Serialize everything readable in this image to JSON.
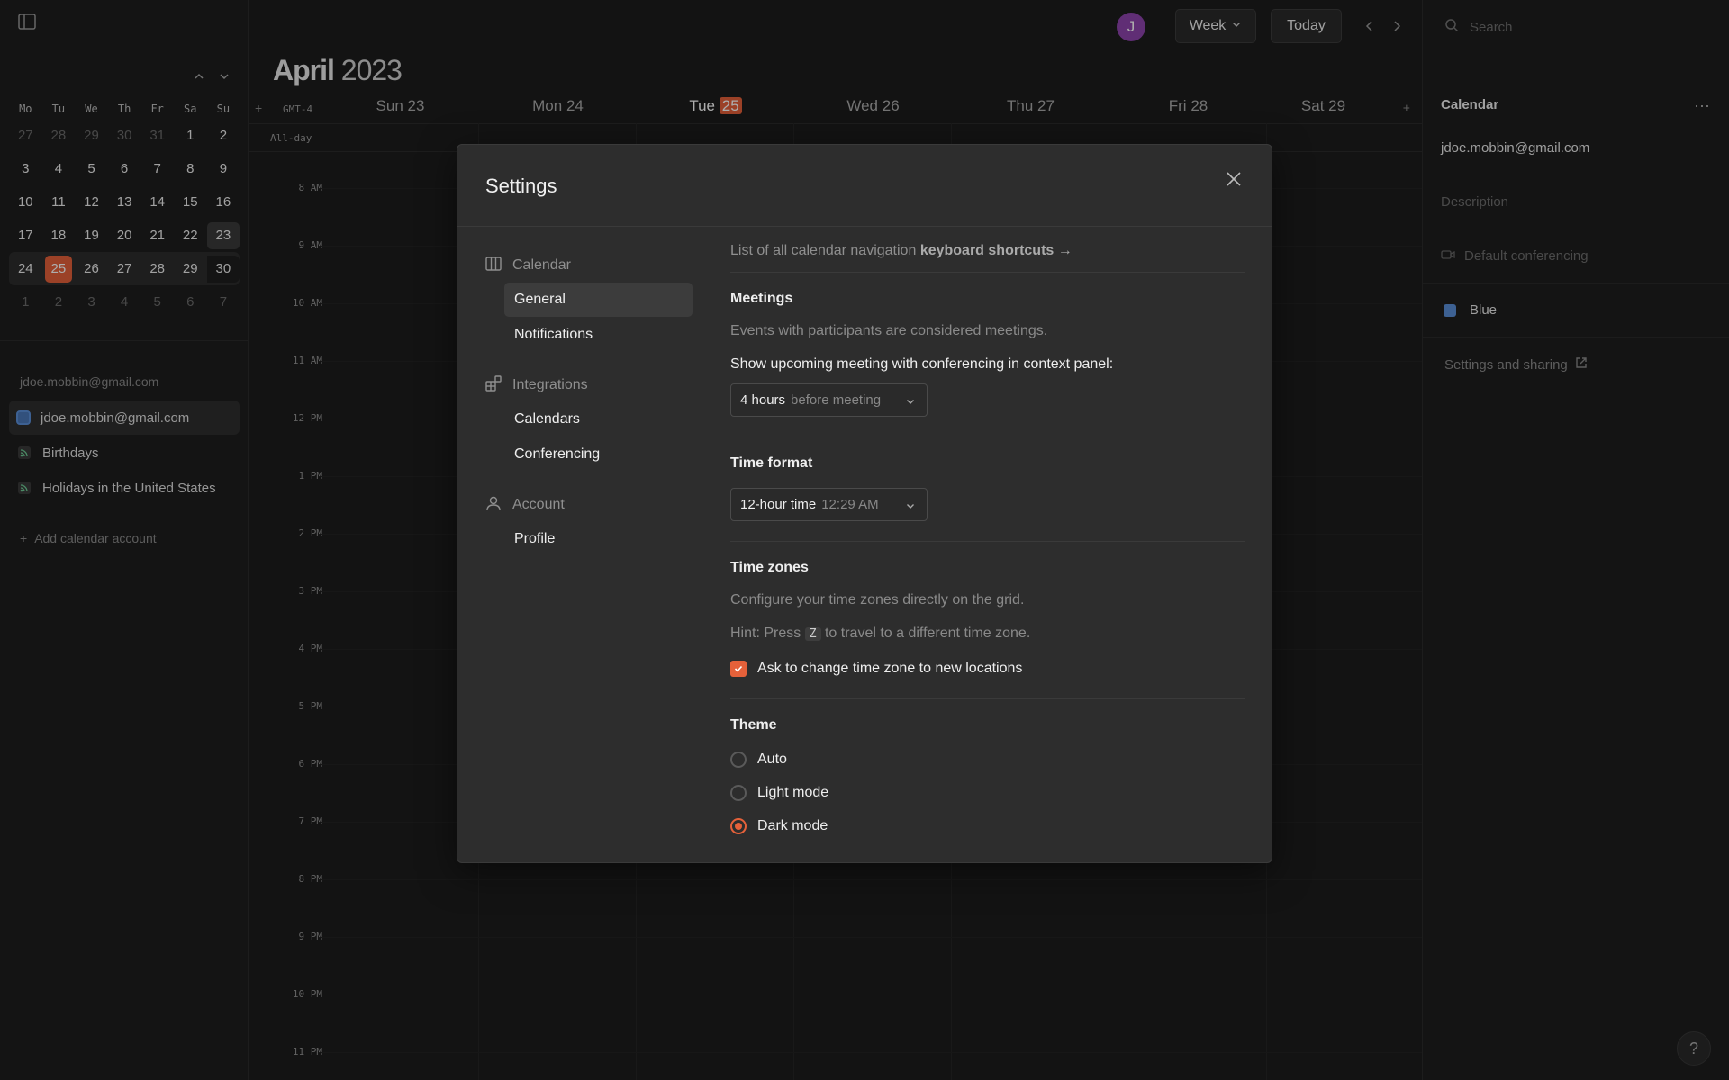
{
  "sidebar": {
    "mini_cal": {
      "headers": [
        "Mo",
        "Tu",
        "We",
        "Th",
        "Fr",
        "Sa",
        "Su"
      ],
      "weeks": [
        [
          "27",
          "28",
          "29",
          "30",
          "31",
          "1",
          "2"
        ],
        [
          "3",
          "4",
          "5",
          "6",
          "7",
          "8",
          "9"
        ],
        [
          "10",
          "11",
          "12",
          "13",
          "14",
          "15",
          "16"
        ],
        [
          "17",
          "18",
          "19",
          "20",
          "21",
          "22",
          "23"
        ],
        [
          "24",
          "25",
          "26",
          "27",
          "28",
          "29",
          "30"
        ],
        [
          "1",
          "2",
          "3",
          "4",
          "5",
          "6",
          "7"
        ]
      ]
    },
    "account_label": "jdoe.mobbin@gmail.com",
    "calendars": [
      {
        "label": "jdoe.mobbin@gmail.com"
      },
      {
        "label": "Birthdays"
      },
      {
        "label": "Holidays in the United States"
      }
    ],
    "add_calendar": "Add calendar account"
  },
  "topbar": {
    "avatar_initial": "J",
    "view_label": "Week",
    "today_label": "Today"
  },
  "calendar": {
    "month": "April",
    "year": "2023",
    "tz_label": "GMT-4",
    "days": [
      {
        "name": "Sun",
        "num": "23"
      },
      {
        "name": "Mon",
        "num": "24"
      },
      {
        "name": "Tue",
        "num": "25"
      },
      {
        "name": "Wed",
        "num": "26"
      },
      {
        "name": "Thu",
        "num": "27"
      },
      {
        "name": "Fri",
        "num": "28"
      },
      {
        "name": "Sat",
        "num": "29"
      }
    ],
    "allday_label": "All-day",
    "hours": [
      "8 AM",
      "9 AM",
      "10 AM",
      "11 AM",
      "12 PM",
      "1 PM",
      "2 PM",
      "3 PM",
      "4 PM",
      "5 PM",
      "6 PM",
      "7 PM",
      "8 PM",
      "9 PM",
      "10 PM",
      "11 PM"
    ]
  },
  "right_panel": {
    "search_placeholder": "Search",
    "title": "Calendar",
    "email": "jdoe.mobbin@gmail.com",
    "description_placeholder": "Description",
    "conferencing": "Default conferencing",
    "color": "Blue",
    "settings_link": "Settings and sharing"
  },
  "settings": {
    "title": "Settings",
    "nav": {
      "calendar_section": "Calendar",
      "general": "General",
      "notifications": "Notifications",
      "integrations_section": "Integrations",
      "calendars": "Calendars",
      "conferencing": "Conferencing",
      "account_section": "Account",
      "profile": "Profile"
    },
    "shortcuts_prefix": "List of all calendar navigation",
    "shortcuts_link": "keyboard shortcuts →",
    "meetings": {
      "heading": "Meetings",
      "desc": "Events with participants are considered meetings.",
      "label": "Show upcoming meeting with conferencing in context panel:",
      "value": "4 hours",
      "suffix": "before meeting"
    },
    "time_format": {
      "heading": "Time format",
      "value": "12-hour time",
      "example": "12:29 AM"
    },
    "time_zones": {
      "heading": "Time zones",
      "desc": "Configure your time zones directly on the grid.",
      "hint_prefix": "Hint: Press",
      "hint_key": "Z",
      "hint_suffix": "to travel to a different time zone.",
      "checkbox_label": "Ask to change time zone to new locations"
    },
    "theme": {
      "heading": "Theme",
      "options": [
        "Auto",
        "Light mode",
        "Dark mode"
      ],
      "selected": "Dark mode"
    }
  },
  "colors": {
    "accent": "#e5613a",
    "calendar_blue": "#5b8fd9",
    "avatar": "#8e44ad"
  }
}
